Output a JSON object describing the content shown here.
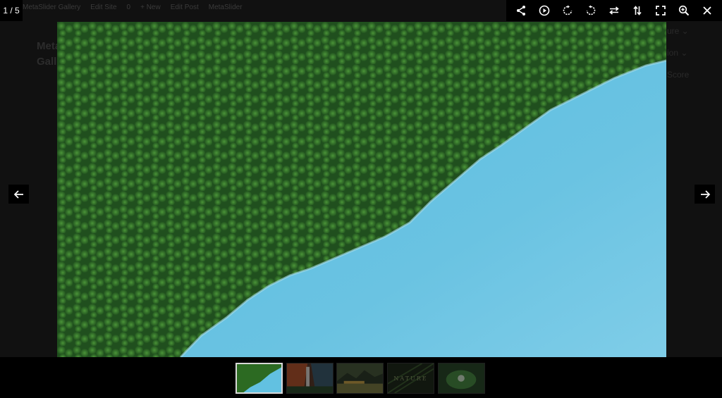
{
  "lightbox": {
    "counter": "1 / 5",
    "toolbar": [
      {
        "name": "share-icon",
        "label": "Share"
      },
      {
        "name": "play-icon",
        "label": "Play"
      },
      {
        "name": "rotate-right-icon",
        "label": "Rotate right"
      },
      {
        "name": "rotate-left-icon",
        "label": "Rotate left"
      },
      {
        "name": "flip-horizontal-icon",
        "label": "Flip horizontal"
      },
      {
        "name": "flip-vertical-icon",
        "label": "Flip vertical"
      },
      {
        "name": "fullscreen-icon",
        "label": "Fullscreen"
      },
      {
        "name": "zoom-in-icon",
        "label": "Zoom in"
      },
      {
        "name": "close-icon",
        "label": "Close"
      }
    ],
    "thumbnails": [
      {
        "name": "thumbnail-forest-lake",
        "active": true,
        "caption": ""
      },
      {
        "name": "thumbnail-waterfall",
        "active": false,
        "caption": ""
      },
      {
        "name": "thumbnail-mountain-lake",
        "active": false,
        "caption": ""
      },
      {
        "name": "thumbnail-nature",
        "active": false,
        "caption": "NATURE"
      },
      {
        "name": "thumbnail-leaf",
        "active": false,
        "caption": ""
      }
    ]
  },
  "background": {
    "admin_bar": [
      "MetaSlider Gallery",
      "Edit Site",
      "0",
      "+ New",
      "Edit Post",
      "MetaSlider"
    ],
    "title_top": "Meta",
    "title_bottom": "Galle",
    "menu": [
      "ure ⌄",
      "ion ⌄",
      "Score"
    ]
  }
}
